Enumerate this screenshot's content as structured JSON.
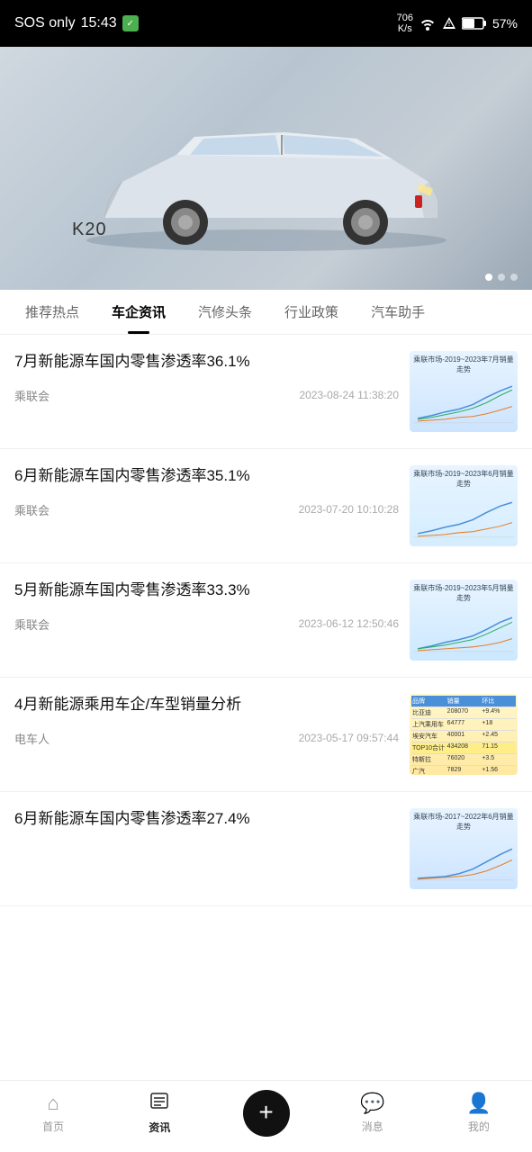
{
  "statusBar": {
    "sos": "SOS only",
    "time": "15:43",
    "networkSpeed": "706",
    "networkUnit": "K/s",
    "battery": "57%"
  },
  "hero": {
    "carModel": "K20",
    "dots": [
      true,
      false,
      false
    ]
  },
  "tabs": [
    {
      "id": "recommend",
      "label": "推荐热点",
      "active": false
    },
    {
      "id": "qiche",
      "label": "车企资讯",
      "active": true
    },
    {
      "id": "qixiu",
      "label": "汽修头条",
      "active": false
    },
    {
      "id": "policy",
      "label": "行业政策",
      "active": false
    },
    {
      "id": "assist",
      "label": "汽车助手",
      "active": false
    }
  ],
  "newsList": [
    {
      "id": 1,
      "title": "7月新能源车国内零售渗透率36.1%",
      "source": "乘联会",
      "date": "2023-08-24 11:38:20",
      "chartType": "line1"
    },
    {
      "id": 2,
      "title": "6月新能源车国内零售渗透率35.1%",
      "source": "乘联会",
      "date": "2023-07-20 10:10:28",
      "chartType": "line2"
    },
    {
      "id": 3,
      "title": "5月新能源车国内零售渗透率33.3%",
      "source": "乘联会",
      "date": "2023-06-12 12:50:46",
      "chartType": "line3"
    },
    {
      "id": 4,
      "title": "4月新能源乘用车企/车型销量分析",
      "source": "电车人",
      "date": "2023-05-17 09:57:44",
      "chartType": "table"
    },
    {
      "id": 5,
      "title": "6月新能源车国内零售渗透率27.4%",
      "source": "",
      "date": "",
      "chartType": "line4"
    }
  ],
  "bottomNav": [
    {
      "id": "home",
      "label": "首页",
      "icon": "⌂",
      "active": false
    },
    {
      "id": "news",
      "label": "资讯",
      "icon": "📰",
      "active": true
    },
    {
      "id": "add",
      "label": "",
      "icon": "+",
      "active": false,
      "isAdd": true
    },
    {
      "id": "messages",
      "label": "消息",
      "icon": "💬",
      "active": false
    },
    {
      "id": "mine",
      "label": "我的",
      "icon": "👤",
      "active": false
    }
  ]
}
